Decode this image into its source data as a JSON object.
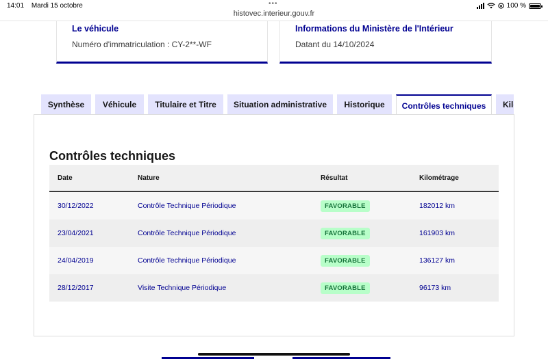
{
  "statusbar": {
    "time": "14:01",
    "date": "Mardi 15 octobre",
    "battery": "100 %",
    "url": "histovec.interieur.gouv.fr"
  },
  "cards": {
    "vehicle": {
      "title": "Le véhicule",
      "text": "Numéro d'immatriculation : CY-2**-WF"
    },
    "ministry": {
      "title": "Informations du Ministère de l'Intérieur",
      "text": "Datant du 14/10/2024"
    }
  },
  "tabs": [
    {
      "label": "Synthèse"
    },
    {
      "label": "Véhicule"
    },
    {
      "label": "Titulaire et Titre"
    },
    {
      "label": "Situation administrative"
    },
    {
      "label": "Historique"
    },
    {
      "label": "Contrôles techniques",
      "active": true
    },
    {
      "label": "Kilo"
    }
  ],
  "section": {
    "title": "Contrôles techniques",
    "headers": {
      "date": "Date",
      "nature": "Nature",
      "result": "Résultat",
      "km": "Kilométrage"
    },
    "rows": [
      {
        "date": "30/12/2022",
        "nature": "Contrôle Technique Périodique",
        "result": "FAVORABLE",
        "km": "182012 km"
      },
      {
        "date": "23/04/2021",
        "nature": "Contrôle Technique Périodique",
        "result": "FAVORABLE",
        "km": "161903 km"
      },
      {
        "date": "24/04/2019",
        "nature": "Contrôle Technique Périodique",
        "result": "FAVORABLE",
        "km": "136127 km"
      },
      {
        "date": "28/12/2017",
        "nature": "Visite Technique Périodique",
        "result": "FAVORABLE",
        "km": "96173 km"
      }
    ]
  },
  "colors": {
    "primary": "#000091",
    "tab_bg": "#e3e3fd",
    "badge_bg": "#b8fec9",
    "badge_text": "#18753c"
  }
}
